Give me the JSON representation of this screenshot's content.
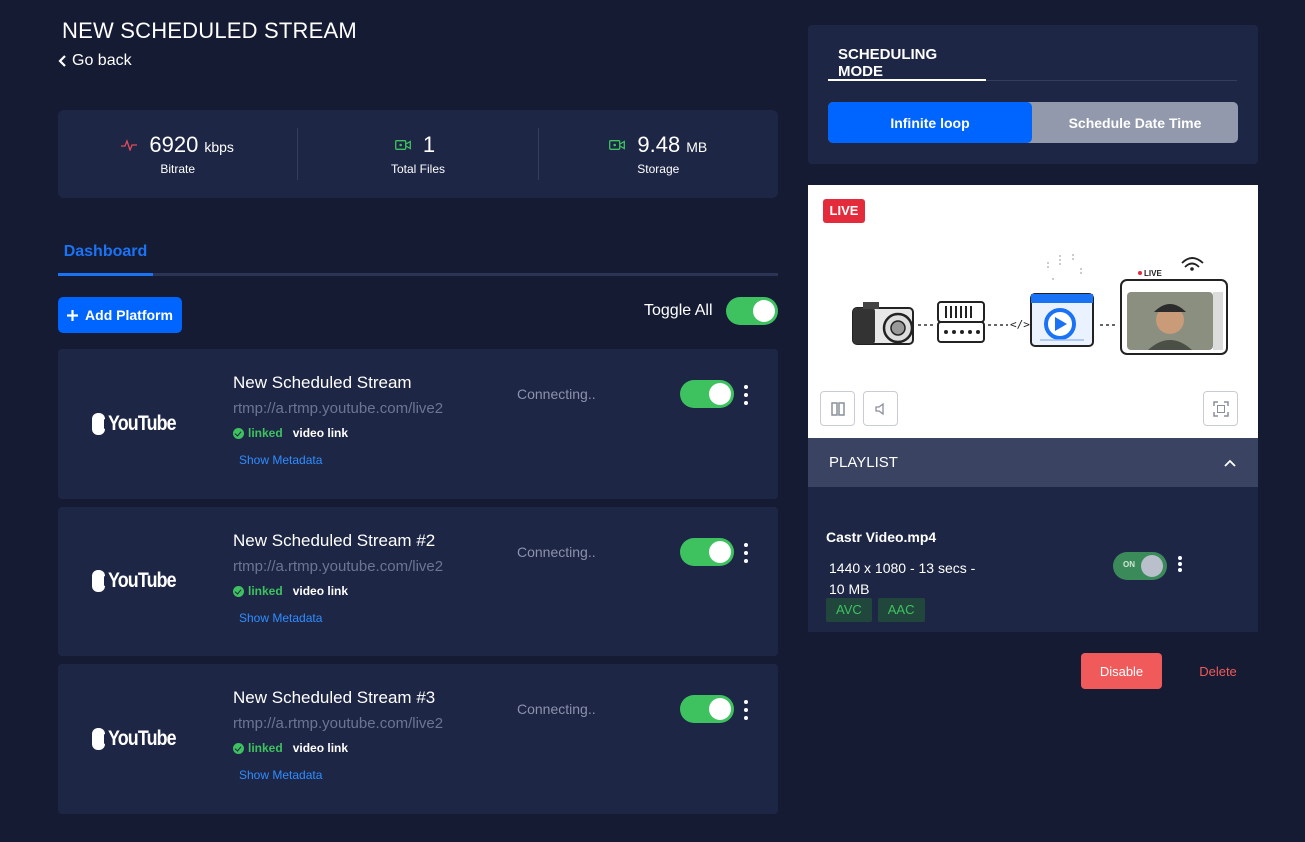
{
  "header": {
    "title": "NEW SCHEDULED STREAM",
    "back_label": "Go back"
  },
  "stats": [
    {
      "value": "6920",
      "unit": "kbps",
      "label": "Bitrate",
      "icon": "pulse-icon",
      "icon_color": "#e34b5a"
    },
    {
      "value": "1",
      "unit": "",
      "label": "Total Files",
      "icon": "video-file-icon",
      "icon_color": "#3ec25f"
    },
    {
      "value": "9.48",
      "unit": "MB",
      "label": "Storage",
      "icon": "storage-icon",
      "icon_color": "#3ec25f"
    }
  ],
  "tabs": {
    "dashboard": "Dashboard"
  },
  "toolbar": {
    "add_platform": "Add Platform",
    "toggle_all": "Toggle All",
    "toggle_all_on": true
  },
  "platforms": [
    {
      "logo": "YouTube",
      "name": "New Scheduled Stream",
      "url": "rtmp://a.rtmp.youtube.com/live2",
      "linked": "linked",
      "video_link": "video link",
      "metadata": "Show Metadata",
      "status": "Connecting..",
      "enabled": true
    },
    {
      "logo": "YouTube",
      "name": "New Scheduled Stream #2",
      "url": "rtmp://a.rtmp.youtube.com/live2",
      "linked": "linked",
      "video_link": "video link",
      "metadata": "Show Metadata",
      "status": "Connecting..",
      "enabled": true
    },
    {
      "logo": "YouTube",
      "name": "New Scheduled Stream #3",
      "url": "rtmp://a.rtmp.youtube.com/live2",
      "linked": "linked",
      "video_link": "video link",
      "metadata": "Show Metadata",
      "status": "Connecting..",
      "enabled": true
    }
  ],
  "scheduling": {
    "tab": "SCHEDULING MODE",
    "modes": [
      "Infinite loop",
      "Schedule Date Time"
    ],
    "active_mode": "Infinite loop"
  },
  "preview": {
    "live_badge": "LIVE",
    "illustration_live_label": "LIVE"
  },
  "playlist": {
    "title": "PLAYLIST",
    "item": {
      "name": "Castr Video.mp4",
      "meta": "1440 x 1080  -  13 secs  -  10 MB",
      "tags": [
        "AVC",
        "AAC"
      ],
      "switch_label": "ON"
    }
  },
  "actions": {
    "disable": "Disable",
    "delete": "Delete"
  },
  "colors": {
    "background": "#151b33",
    "panel": "#1e2645",
    "accent": "#0064ff",
    "success": "#3ec25f",
    "danger": "#f05a5a",
    "live": "#e32b3c"
  }
}
